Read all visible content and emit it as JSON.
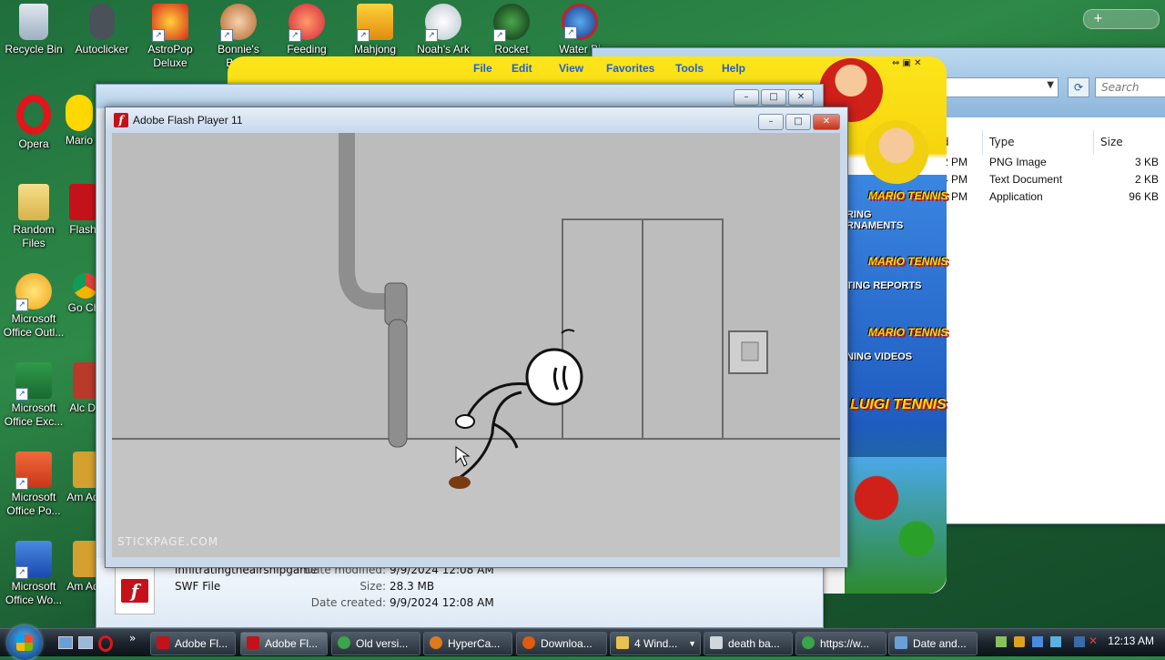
{
  "desktop": {
    "icons": [
      {
        "label": "Recycle Bin"
      },
      {
        "label": "Autoclicker"
      },
      {
        "label": "AstroPop Deluxe"
      },
      {
        "label": "Bonnie's Book"
      },
      {
        "label": "Feeding"
      },
      {
        "label": "Mahjong"
      },
      {
        "label": "Noah's Ark"
      },
      {
        "label": "Rocket"
      },
      {
        "label": "Water Bi"
      },
      {
        "label": "Opera"
      },
      {
        "label": "Mario"
      },
      {
        "label": "Random Files"
      },
      {
        "label": "Flash"
      },
      {
        "label": "Microsoft Office Outl..."
      },
      {
        "label": "Go Chr"
      },
      {
        "label": "Microsoft Office Exc..."
      },
      {
        "label": "Alc De"
      },
      {
        "label": "Microsoft Office Po..."
      },
      {
        "label": "Am Adv"
      },
      {
        "label": "Microsoft Office Wo..."
      },
      {
        "label": "Am Adv"
      }
    ]
  },
  "mario_window": {
    "menu": [
      "File",
      "Edit",
      "View",
      "Favorites",
      "Tools",
      "Help"
    ],
    "tiles": [
      {
        "logo": "MARIO TENNIS",
        "caption": "RING RNAMENTS"
      },
      {
        "logo": "MARIO TENNIS",
        "caption": "TING REPORTS"
      },
      {
        "logo": "MARIO TENNIS",
        "caption": "NING VIDEOS"
      },
      {
        "logo": "LUIGI TENNIS",
        "caption": ""
      }
    ]
  },
  "explorer": {
    "search_placeholder": "Search",
    "columns": {
      "date_partial": "d",
      "type": "Type",
      "size": "Size"
    },
    "rows": [
      {
        "time": "2 PM",
        "type": "PNG Image",
        "size": "3 KB"
      },
      {
        "time": "4 PM",
        "type": "Text Document",
        "size": "2 KB"
      },
      {
        "time": "2 PM",
        "type": "Application",
        "size": "96 KB"
      }
    ]
  },
  "details_pane": {
    "name": "infiltratingtheairshipgame",
    "type": "SWF File",
    "date_modified_label": "Date modified:",
    "date_modified": "9/9/2024 12:08 AM",
    "size_label": "Size:",
    "size": "28.3 MB",
    "date_created_label": "Date created:",
    "date_created": "9/9/2024 12:08 AM"
  },
  "flash_window": {
    "title": "Adobe Flash Player 11",
    "watermark": "STICKPAGE.COM"
  },
  "taskbar": {
    "buttons": [
      {
        "label": "Adobe Fl...",
        "color": "#c4121a"
      },
      {
        "label": "Adobe Fl...",
        "color": "#c4121a"
      },
      {
        "label": "Old versi...",
        "color": "#3aa54a"
      },
      {
        "label": "HyperCa...",
        "color": "#e07a1a"
      },
      {
        "label": "Downloa...",
        "color": "#e05a10"
      },
      {
        "label": "4 Wind...",
        "color": "#e8c050"
      },
      {
        "label": "death ba...",
        "color": "#cfd6de"
      },
      {
        "label": "https://w...",
        "color": "#3aa54a"
      },
      {
        "label": "Date and...",
        "color": "#6aa0d8"
      }
    ],
    "clock": "12:13 AM"
  }
}
